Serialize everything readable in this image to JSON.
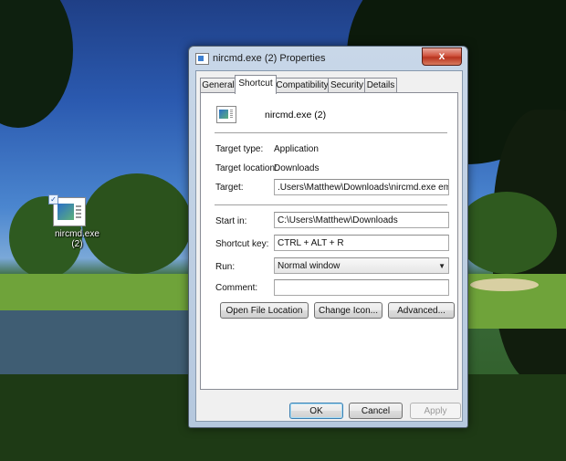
{
  "desktop": {
    "shortcut_label_line1": "nircmd.exe",
    "shortcut_label_line2": "(2)"
  },
  "window": {
    "title": "nircmd.exe (2) Properties",
    "close_glyph": "x"
  },
  "tabs": [
    {
      "label": "General",
      "active": false
    },
    {
      "label": "Shortcut",
      "active": true
    },
    {
      "label": "Compatibility",
      "active": false
    },
    {
      "label": "Security",
      "active": false
    },
    {
      "label": "Details",
      "active": false
    }
  ],
  "shortcut": {
    "file_name": "nircmd.exe (2)",
    "target_type_label": "Target type:",
    "target_type_value": "Application",
    "target_location_label": "Target location:",
    "target_location_value": "Downloads",
    "target_label": "Target:",
    "target_value": ".Users\\Matthew\\Downloads\\nircmd.exe emptybin",
    "start_in_label": "Start in:",
    "start_in_value": "C:\\Users\\Matthew\\Downloads",
    "shortcut_key_label": "Shortcut key:",
    "shortcut_key_value": "CTRL + ALT + R",
    "run_label": "Run:",
    "run_value": "Normal window",
    "comment_label": "Comment:",
    "comment_value": ""
  },
  "buttons": {
    "open_file_location": "Open File Location",
    "change_icon": "Change Icon...",
    "advanced": "Advanced...",
    "ok": "OK",
    "cancel": "Cancel",
    "apply": "Apply"
  },
  "icons": {
    "window_icon": "shortcut-app-icon",
    "file_icon": "application-icon",
    "dropdown": "chevron-down-icon"
  }
}
